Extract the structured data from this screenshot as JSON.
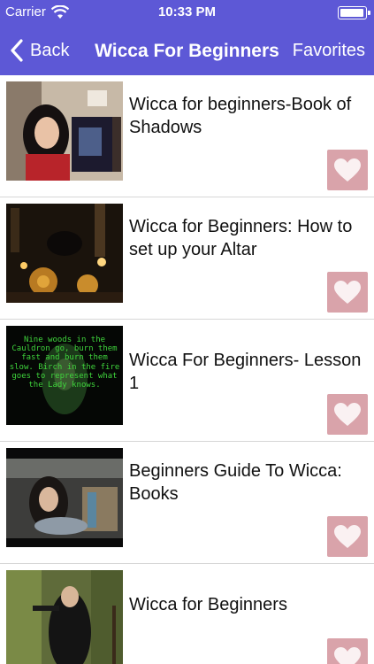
{
  "status_bar": {
    "carrier": "Carrier",
    "time": "10:33 PM"
  },
  "nav": {
    "back_label": "Back",
    "title": "Wicca For Beginners",
    "favorites_label": "Favorites"
  },
  "videos": [
    {
      "title": "Wicca for beginners-Book of Shadows"
    },
    {
      "title": "Wicca for Beginners: How to set up your Altar"
    },
    {
      "title": "Wicca For Beginners- Lesson 1",
      "thumb_text": "Nine woods in the Cauldron go, burn them fast and burn them slow. Birch in the fire goes to represent what the Lady knows."
    },
    {
      "title": "Beginners Guide To Wicca: Books"
    },
    {
      "title": "Wicca for Beginners"
    }
  ],
  "colors": {
    "header": "#5d58d6",
    "favorite_button": "#d9a3aa",
    "thumb_text": "#3fd43c"
  }
}
